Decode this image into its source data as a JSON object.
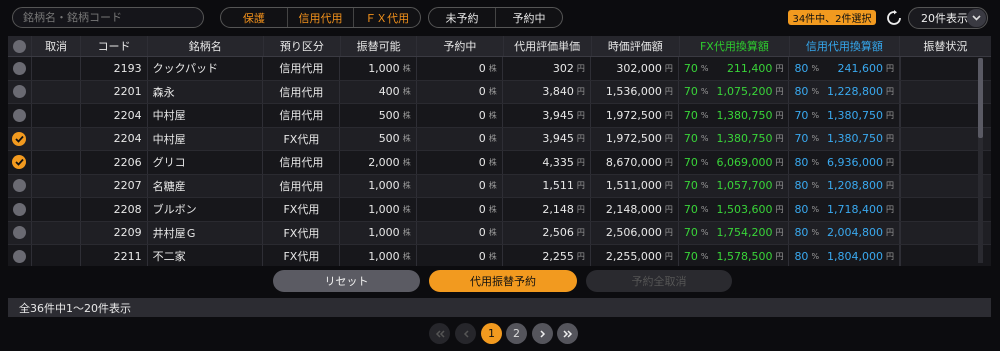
{
  "toolbar": {
    "search_placeholder": "銘柄名・銘柄コード",
    "filter_group1": [
      "保護",
      "信用代用",
      "ＦＸ代用"
    ],
    "filter_group2": [
      "未予約",
      "予約中"
    ],
    "selection_badge": "34件中、2件選択",
    "per_page": "20件表示"
  },
  "table": {
    "headers": [
      "取消",
      "コード",
      "銘柄名",
      "預り区分",
      "振替可能",
      "予約中",
      "代用評価単価",
      "時価評価額",
      "FX代用換算額",
      "信用代用換算額",
      "振替状況"
    ],
    "rows": [
      {
        "checked": false,
        "code": "2193",
        "name": "クックパッド",
        "kubun": "信用代用",
        "avail": "1,000",
        "reserved": "0",
        "unit_price": "302",
        "market": "302,000",
        "fx_pct": "70",
        "fx_amt": "211,400",
        "cr_pct": "80",
        "cr_amt": "241,600"
      },
      {
        "checked": false,
        "code": "2201",
        "name": "森永",
        "kubun": "信用代用",
        "avail": "400",
        "reserved": "0",
        "unit_price": "3,840",
        "market": "1,536,000",
        "fx_pct": "70",
        "fx_amt": "1,075,200",
        "cr_pct": "80",
        "cr_amt": "1,228,800"
      },
      {
        "checked": false,
        "code": "2204",
        "name": "中村屋",
        "kubun": "信用代用",
        "avail": "500",
        "reserved": "0",
        "unit_price": "3,945",
        "market": "1,972,500",
        "fx_pct": "70",
        "fx_amt": "1,380,750",
        "cr_pct": "70",
        "cr_amt": "1,380,750"
      },
      {
        "checked": true,
        "code": "2204",
        "name": "中村屋",
        "kubun": "FX代用",
        "avail": "500",
        "reserved": "0",
        "unit_price": "3,945",
        "market": "1,972,500",
        "fx_pct": "70",
        "fx_amt": "1,380,750",
        "cr_pct": "70",
        "cr_amt": "1,380,750"
      },
      {
        "checked": true,
        "code": "2206",
        "name": "グリコ",
        "kubun": "信用代用",
        "avail": "2,000",
        "reserved": "0",
        "unit_price": "4,335",
        "market": "8,670,000",
        "fx_pct": "70",
        "fx_amt": "6,069,000",
        "cr_pct": "80",
        "cr_amt": "6,936,000"
      },
      {
        "checked": false,
        "code": "2207",
        "name": "名糖産",
        "kubun": "信用代用",
        "avail": "1,000",
        "reserved": "0",
        "unit_price": "1,511",
        "market": "1,511,000",
        "fx_pct": "70",
        "fx_amt": "1,057,700",
        "cr_pct": "80",
        "cr_amt": "1,208,800"
      },
      {
        "checked": false,
        "code": "2208",
        "name": "ブルボン",
        "kubun": "FX代用",
        "avail": "1,000",
        "reserved": "0",
        "unit_price": "2,148",
        "market": "2,148,000",
        "fx_pct": "70",
        "fx_amt": "1,503,600",
        "cr_pct": "80",
        "cr_amt": "1,718,400"
      },
      {
        "checked": false,
        "code": "2209",
        "name": "井村屋Ｇ",
        "kubun": "FX代用",
        "avail": "1,000",
        "reserved": "0",
        "unit_price": "2,506",
        "market": "2,506,000",
        "fx_pct": "70",
        "fx_amt": "1,754,200",
        "cr_pct": "80",
        "cr_amt": "2,004,800"
      },
      {
        "checked": false,
        "code": "2211",
        "name": "不二家",
        "kubun": "FX代用",
        "avail": "1,000",
        "reserved": "0",
        "unit_price": "2,255",
        "market": "2,255,000",
        "fx_pct": "70",
        "fx_amt": "1,578,500",
        "cr_pct": "80",
        "cr_amt": "1,804,000"
      }
    ],
    "unit_kabu": "株",
    "unit_yen": "円",
    "unit_pct": "%"
  },
  "actions": {
    "reset": "リセット",
    "reserve": "代用振替予約",
    "cancel_all": "予約全取消"
  },
  "status": "全36件中1〜20件表示",
  "pager": {
    "pages": [
      "1",
      "2"
    ],
    "current": "1"
  },
  "colors": {
    "accent": "#f29a1f",
    "fx": "#39d439",
    "credit": "#3aa9ef"
  }
}
